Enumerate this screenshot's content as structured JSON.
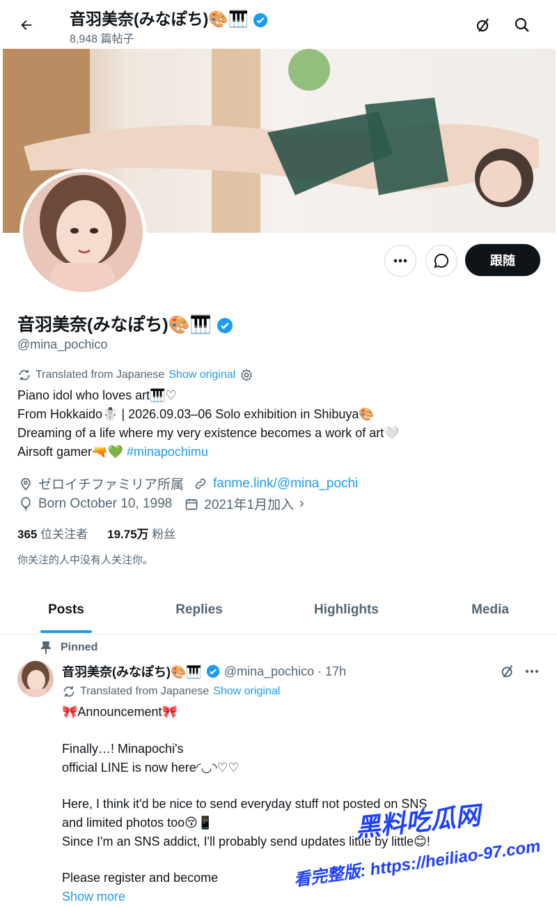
{
  "header": {
    "back_label": "back",
    "name": "音羽美奈(みなぽち)🎨🎹",
    "post_count": "8,948 篇帖子"
  },
  "profile": {
    "display_name": "音羽美奈(みなぽち)🎨🎹",
    "handle": "@mina_pochico",
    "follow_label": "跟随",
    "translated_note": "Translated from Japanese",
    "show_original": "Show original",
    "bio": [
      "Piano idol who loves art🎹♡",
      "From Hokkaido☃️ | 2026.09.03–06 Solo exhibition in Shibuya🎨",
      "Dreaming of a life where my very existence becomes a work of art🤍",
      "Airsoft gamer🔫💚"
    ],
    "hashtag": "#minapochimu",
    "affiliation": "ゼロイチファミリア所属",
    "link": "fanme.link/@mina_pochi",
    "birthday": "Born October 10, 1998",
    "joined": "2021年1月加入",
    "following_count": "365",
    "following_label": "位关注者",
    "followers_count": "19.75万",
    "followers_label": "粉丝",
    "mutual_note": "你关注的人中没有人关注你。"
  },
  "tabs": [
    "Posts",
    "Replies",
    "Highlights",
    "Media"
  ],
  "pinned_post": {
    "pinned_label": "Pinned",
    "author_name": "音羽美奈(みなぽち)🎨🎹",
    "handle_time": "@mina_pochico · 17h",
    "translated_note": "Translated from Japanese",
    "show_original": "Show original",
    "lines": [
      "🎀Announcement🎀",
      "Finally…! Minapochi's",
      "official LINE is now here◜◡◝♡♡",
      "Here, I think it'd be nice to send everyday stuff not posted on SNS",
      "and limited photos too😚📱",
      "Since I'm an SNS addict, I'll probably send updates little by little😊!",
      "Please register and become"
    ],
    "show_more": "Show more"
  },
  "watermark": {
    "title": "黑料吃瓜网",
    "subtitle": "看完整版: https://heiliao-97.com"
  },
  "colors": {
    "accent": "#1d9bf0",
    "text": "#0f1419",
    "muted": "#536471",
    "follow_bg": "#0f1419",
    "watermark": "#1e40ff"
  },
  "icons": [
    "back-arrow-icon",
    "grok-icon",
    "search-icon",
    "more-icon",
    "message-icon",
    "verified-badge-icon",
    "translate-icon",
    "gear-icon",
    "location-icon",
    "link-icon",
    "balloon-icon",
    "calendar-icon",
    "pin-icon"
  ]
}
